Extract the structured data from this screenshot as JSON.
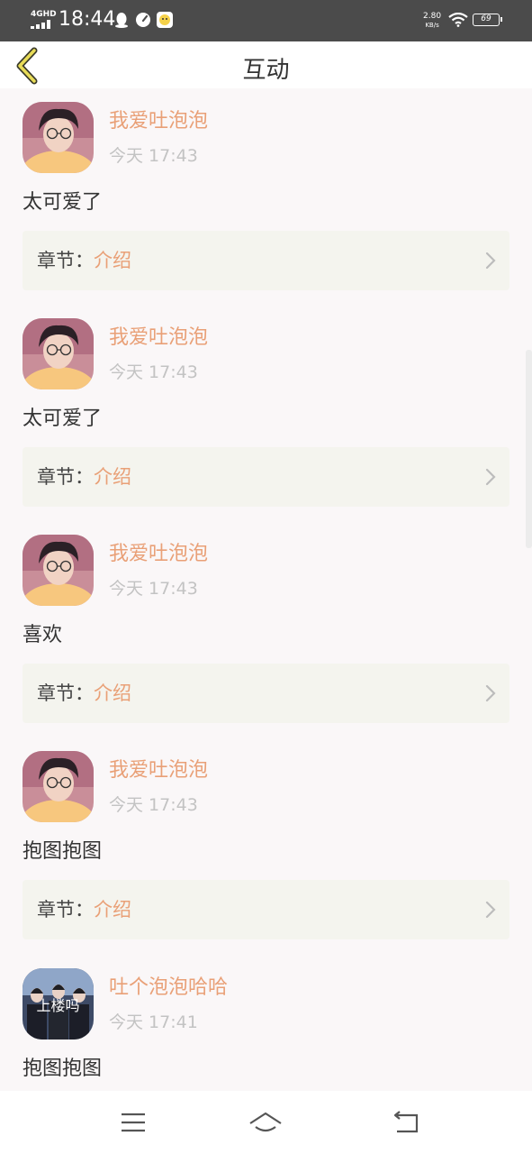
{
  "status_bar": {
    "network": "4GHD",
    "time": "18:44",
    "speed_value": "2.80",
    "speed_unit": "KB/s",
    "battery": "69",
    "icons": [
      "qq-icon",
      "speedometer-icon",
      "emoji-app-icon",
      "wifi-icon",
      "battery-icon"
    ]
  },
  "header": {
    "title": "互动",
    "back_icon": "chevron-left-icon"
  },
  "chapter_prefix": "章节：",
  "items": [
    {
      "username": "我爱吐泡泡",
      "time": "今天 17:43",
      "comment": "太可爱了",
      "chapter": "介绍",
      "avatar": "boy-with-glasses"
    },
    {
      "username": "我爱吐泡泡",
      "time": "今天 17:43",
      "comment": "太可爱了",
      "chapter": "介绍",
      "avatar": "boy-with-glasses"
    },
    {
      "username": "我爱吐泡泡",
      "time": "今天 17:43",
      "comment": "喜欢",
      "chapter": "介绍",
      "avatar": "boy-with-glasses"
    },
    {
      "username": "我爱吐泡泡",
      "time": "今天 17:43",
      "comment": "抱图抱图",
      "chapter": "介绍",
      "avatar": "boy-with-glasses"
    },
    {
      "username": "吐个泡泡哈哈",
      "time": "今天 17:41",
      "comment": "抱图抱图",
      "avatar": "group-photo",
      "avatar_caption": "上楼吗"
    }
  ],
  "colors": {
    "accent": "#e9a077",
    "background": "#faf7f8",
    "chapter_box": "#f4f4ee",
    "time_text": "#c3c3c3",
    "status_bar": "#4b4b4b",
    "back_arrow": "#e8dc58"
  },
  "nav_bar": {
    "buttons": [
      "menu-icon",
      "home-icon",
      "back-icon"
    ]
  }
}
